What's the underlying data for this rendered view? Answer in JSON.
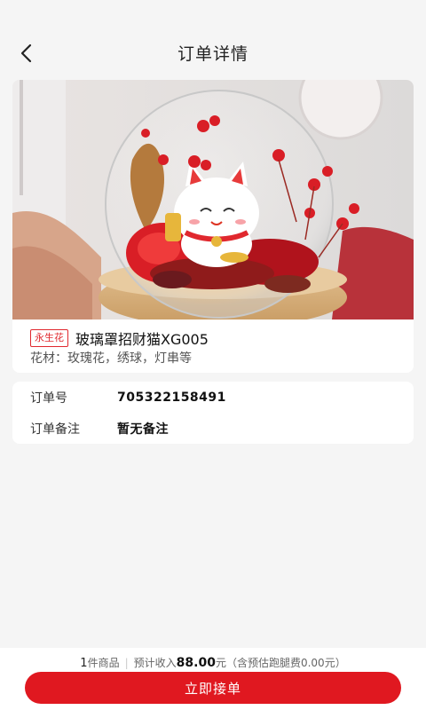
{
  "header": {
    "title": "订单详情"
  },
  "product": {
    "tag": "永生花",
    "name": "玻璃罩招财猫XG005",
    "material_label": "花材：",
    "material_value": "玫瑰花，绣球，灯串等"
  },
  "order": {
    "number_label": "订单号",
    "number_value": "705322158491",
    "note_label": "订单备注",
    "note_value": "暂无备注"
  },
  "footer": {
    "count": "1",
    "count_suffix": "件商品",
    "separator": "|",
    "income_label": "预计收入",
    "income_amount": "88.00",
    "income_unit": "元",
    "fee_note": "（含预估跑腿费0.00元）",
    "accept_label": "立即接单"
  },
  "colors": {
    "accent": "#e01820",
    "tag": "#e0282e",
    "background": "#f5f5f5"
  }
}
